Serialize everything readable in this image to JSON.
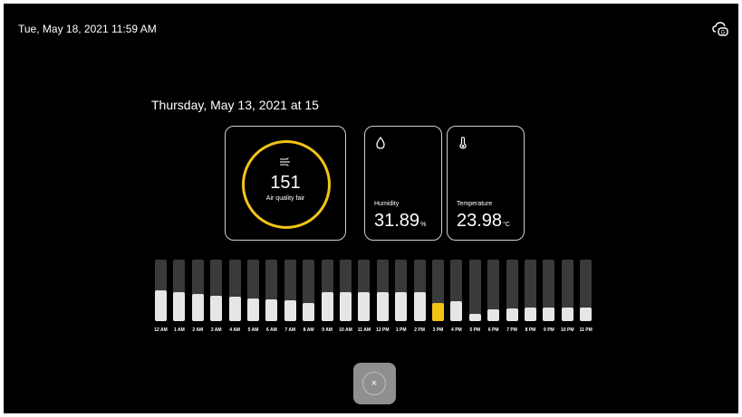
{
  "header": {
    "datetime": "Tue, May 18, 2021 11:59 AM",
    "icon": "cloud-sync-icon"
  },
  "selected_date": "Thursday, May 13, 2021 at 15",
  "air_quality": {
    "value": "151",
    "label": "Air quality fair",
    "icon": "wind-icon",
    "ring_color": "#f2c418"
  },
  "humidity": {
    "label": "Humidity",
    "value": "31.89",
    "unit": "%",
    "icon": "water-drop-icon"
  },
  "temperature": {
    "label": "Temperature",
    "value": "23.98",
    "unit": "°C",
    "icon": "thermometer-icon"
  },
  "hourly": {
    "active_index": 15,
    "active_color": "#f2c418",
    "labels": [
      "12 AM",
      "1 AM",
      "2 AM",
      "3 AM",
      "4 AM",
      "5 AM",
      "6 AM",
      "7 AM",
      "8 AM",
      "9 AM",
      "10 AM",
      "11 AM",
      "12 PM",
      "1 PM",
      "2 PM",
      "3 PM",
      "4 PM",
      "5 PM",
      "6 PM",
      "7 PM",
      "8 PM",
      "9 PM",
      "10 PM",
      "11 PM"
    ],
    "levels": [
      0.5,
      0.47,
      0.44,
      0.41,
      0.39,
      0.37,
      0.35,
      0.34,
      0.29,
      0.47,
      0.47,
      0.47,
      0.47,
      0.47,
      0.47,
      0.29,
      0.32,
      0.12,
      0.19,
      0.21,
      0.22,
      0.22,
      0.22,
      0.22
    ]
  },
  "close_button": {
    "label": "×",
    "icon": "close-icon"
  }
}
